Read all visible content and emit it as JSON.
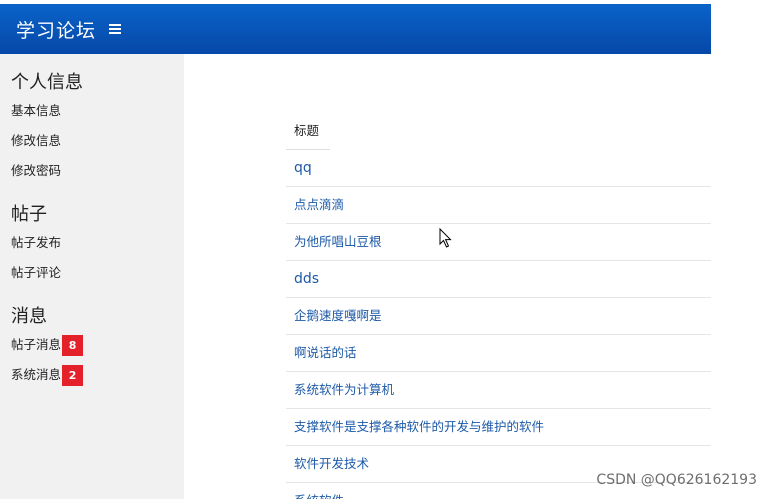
{
  "header": {
    "title": "学习论坛",
    "menu_icon": "menu-icon"
  },
  "sidebar": {
    "sections": [
      {
        "title": "个人信息",
        "items": [
          {
            "label": "基本信息"
          },
          {
            "label": "修改信息"
          },
          {
            "label": "修改密码"
          }
        ]
      },
      {
        "title": "帖子",
        "items": [
          {
            "label": "帖子发布"
          },
          {
            "label": "帖子评论"
          }
        ]
      },
      {
        "title": "消息",
        "items": [
          {
            "label": "帖子消息",
            "badge": "8"
          },
          {
            "label": "系统消息",
            "badge": "2"
          }
        ]
      }
    ],
    "badge_color": "#e4202a"
  },
  "table": {
    "header": "标题",
    "rows": [
      "qq",
      "点点滴滴",
      "为他所唱山豆根",
      "dds",
      "企鹅速度嘎啊是",
      "啊说话的话",
      "系统软件为计算机",
      "支撑软件是支撑各种软件的开发与维护的软件",
      "软件开发技术",
      "系统软件"
    ]
  },
  "watermark": "CSDN @QQ626162193",
  "colors": {
    "header_bg": "#0648a8",
    "sidebar_bg": "#f1f1f1",
    "link": "#1d5aa8"
  }
}
